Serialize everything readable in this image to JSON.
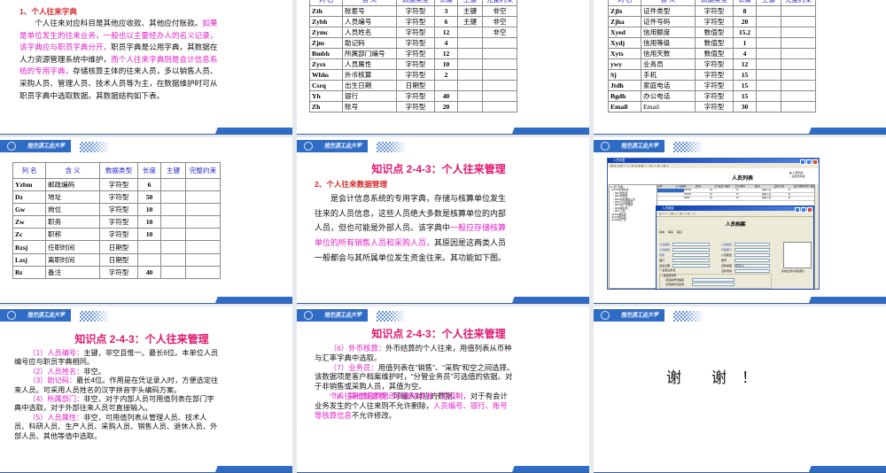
{
  "logo": {
    "cn": "哈尔滨工业大学",
    "en": "Harbin Institute of Technology"
  },
  "table_headers": [
    "列 名",
    "含 义",
    "数据类型",
    "长度",
    "主键",
    "完整约束"
  ],
  "slides": {
    "s1": {
      "heading": "1、个人往来字典",
      "paragraph": [
        {
          "t": "个人往来对应科目是其他应收款、其他应付账款。",
          "hl": false
        },
        {
          "t": "如果是单位发生的往来业务，一般也以主要经办人的名义记录，该字典应与职员字典分开，",
          "hl": true
        },
        {
          "t": "职员字典是公用字典，其数据在人力资源管理系统中维护，",
          "hl": false
        },
        {
          "t": "而个人往来字典则是会计信息系统的专用字典，",
          "hl": true
        },
        {
          "t": "存储核算主体的往来人员，多以销售人员、采购人员、管理人员、技术人员等为主，在数据维护时可从职员字典中选取数据。其数据结构如下表。",
          "hl": false
        }
      ]
    },
    "s2": {
      "rows": [
        [
          "Zth",
          "账套号",
          "字符型",
          "3",
          "主键",
          "非空"
        ],
        [
          "Zybh",
          "人员编号",
          "字符型",
          "6",
          "主键",
          "非空"
        ],
        [
          "Zymc",
          "人员姓名",
          "字符型",
          "12",
          "",
          "非空"
        ],
        [
          "Zjm",
          "助记码",
          "字符型",
          "4",
          "",
          ""
        ],
        [
          "Bmbh",
          "所属部门编号",
          "字符型",
          "12",
          "",
          ""
        ],
        [
          "Zysx",
          "人员属性",
          "字符型",
          "10",
          "",
          ""
        ],
        [
          "Wbhs",
          "外币核算",
          "字符型",
          "2",
          "",
          ""
        ],
        [
          "Csrq",
          "出生日期",
          "日期型",
          "",
          "",
          ""
        ],
        [
          "Yh",
          "银行",
          "字符型",
          "40",
          "",
          ""
        ],
        [
          "Zh",
          "账号",
          "字符型",
          "20",
          "",
          ""
        ]
      ]
    },
    "s3": {
      "rows": [
        [
          "Zjlx",
          "证件类型",
          "字符型",
          "8",
          "",
          ""
        ],
        [
          "Zjha",
          "证件号码",
          "字符型",
          "20",
          "",
          ""
        ],
        [
          "Xyed",
          "信用额度",
          "数值型",
          "15.2",
          "",
          ""
        ],
        [
          "Xydj",
          "信用等级",
          "数值型",
          "1",
          "",
          ""
        ],
        [
          "Xyts",
          "信用天数",
          "数值型",
          "4",
          "",
          ""
        ],
        [
          "ywy",
          "业务员",
          "字符型",
          "12",
          "",
          ""
        ],
        [
          "Sj",
          "手机",
          "字符型",
          "15",
          "",
          ""
        ],
        [
          "Jtdh",
          "家庭电话",
          "字符型",
          "15",
          "",
          ""
        ],
        [
          "Bgdh",
          "办公电话",
          "字符型",
          "15",
          "",
          ""
        ],
        [
          "Email",
          "Email",
          "字符型",
          "30",
          "",
          ""
        ]
      ]
    },
    "s4": {
      "rows": [
        [
          "Yzbm",
          "邮政编码",
          "字符型",
          "6",
          "",
          ""
        ],
        [
          "Dz",
          "地址",
          "字符型",
          "50",
          "",
          ""
        ],
        [
          "Gw",
          "岗位",
          "字符型",
          "10",
          "",
          ""
        ],
        [
          "Zw",
          "职务",
          "字符型",
          "10",
          "",
          ""
        ],
        [
          "Zc",
          "职称",
          "字符型",
          "10",
          "",
          ""
        ],
        [
          "Rzsj",
          "任职时间",
          "日期型",
          "",
          "",
          ""
        ],
        [
          "Lzsj",
          "离职时间",
          "日期型",
          "",
          "",
          ""
        ],
        [
          "Bz",
          "备注",
          "字符型",
          "40",
          "",
          ""
        ]
      ]
    },
    "s5": {
      "title": "知识点 2-4-3：个人往来管理",
      "heading": "2、个人往来数据管理",
      "paragraph": [
        {
          "t": "是会计信息系统的专用字典，存储与核算单位发生往来的人员信息，这些人员绝大多数是核算单位的内部人员，但也可能是外部人员。该字典中",
          "hl": false
        },
        {
          "t": "一般应存储核算单位的所有销售人员和采购人员，",
          "hl": true
        },
        {
          "t": "其原因是这两类人员一般都会与其所属单位发生资金往来。其功能如下图。",
          "hl": false
        }
      ]
    },
    "s6": {
      "list_window_title": "人员列表",
      "list_title": "人员列表",
      "radio_1": "人员列表",
      "radio_2": "业务员列表",
      "tree": [
        "部门分类",
        "001总部机关",
        "0011财务部",
        "0012供销部",
        "0013总经理办公室",
        "0014人力资源部",
        "0015资产管理部",
        "0016组织部",
        "0017工会",
        "002销售部",
        "003供应部",
        "004生产部"
      ],
      "grid_headers": [
        "选择",
        "人员编码",
        "姓名",
        "行政部门编码",
        "人员类别",
        "性别",
        "出生日期",
        "业务或费用部门编码"
      ],
      "grid_rows": [
        [
          "000003",
          "刘…",
          "00",
          "在职人员",
          "男"
        ],
        [
          "000011",
          "郭…",
          "00",
          "在职人员",
          "男"
        ],
        [
          "00001",
          "郭…",
          "00",
          "在职人员",
          "男"
        ]
      ],
      "dialog_title": "人员档案",
      "dialog_heading": "人员档案",
      "tabs": [
        "基本",
        "联系",
        "其它"
      ],
      "left_labels": [
        "人员编码",
        "人员类别",
        "性别",
        "银行",
        "出生日期"
      ],
      "right_labels": [
        "人员姓名",
        "行政部门",
        "人员属性",
        "账号",
        "证件类型",
        "证件号码"
      ],
      "id_type": "身份证",
      "chk_salesman": "是否业务员",
      "chk_operator": "是否操作员",
      "op_code": "对应操作员编码",
      "op_name": "对应操作员名称",
      "photo_caption": "请在此方框内添加照片"
    },
    "s7": {
      "title": "知识点 2-4-3：个人往来管理",
      "items": [
        {
          "label": "（1）人员编号：",
          "text": "主键，非空且惟一。最长6位。本单位人员编号应与职员字典相同。"
        },
        {
          "label": "（2）人员姓名：",
          "text": "非空。"
        },
        {
          "label": "（3）助记码：",
          "text": "最长4位。作用是在凭证录入时，方便选定往来人员。可采用人员姓名的汉字拼音字头编码方案。"
        },
        {
          "label": "（4）所属部门：",
          "text": "非空，对于内部人员可用值列表在部门字典中选取，对于外部往来人员可直接输入。"
        },
        {
          "label": "（5）人员属性：",
          "text": "非空，可用值列表从管理人员、技术人员、科研人员、生产人员、采购人员、销售人员、退休人员、外部人员、其他等值中选取。"
        }
      ]
    },
    "s8": {
      "title": "知识点 2-4-3：个人往来管理",
      "items": [
        {
          "label": "（6）外币核算：",
          "text": "外币结算的个人往来，用值列表从币种与汇率字典中选取。"
        },
        {
          "label": "（7）业务员：",
          "text": "用值列表在“销售”、“采购”和空之间选择。该数据项是客户档案维护时，“分管业务员”可选值的依据。对于非销售或采购人员，其值为空。"
        },
        {
          "label": "（8）其他数据项：",
          "text": "可输入对应的数据。"
        }
      ],
      "note": [
        {
          "t": "个人往来信息的修改和删除具有一定限制，",
          "hl": true
        },
        {
          "t": "对于有会计业务发生的个人往来则不允许删除，",
          "hl": false
        },
        {
          "t": "人员编号、银行、账号等核算信息",
          "hl": true
        },
        {
          "t": "不允许修改。",
          "hl": false
        }
      ]
    },
    "s9": {
      "text": "谢　　谢　！"
    }
  },
  "colors": {
    "brand_blue": "#2f6cc6",
    "highlight": "#e020c8",
    "title": "#e0176e",
    "heading_red": "#d42a2a",
    "table_header": "#2525c8"
  }
}
